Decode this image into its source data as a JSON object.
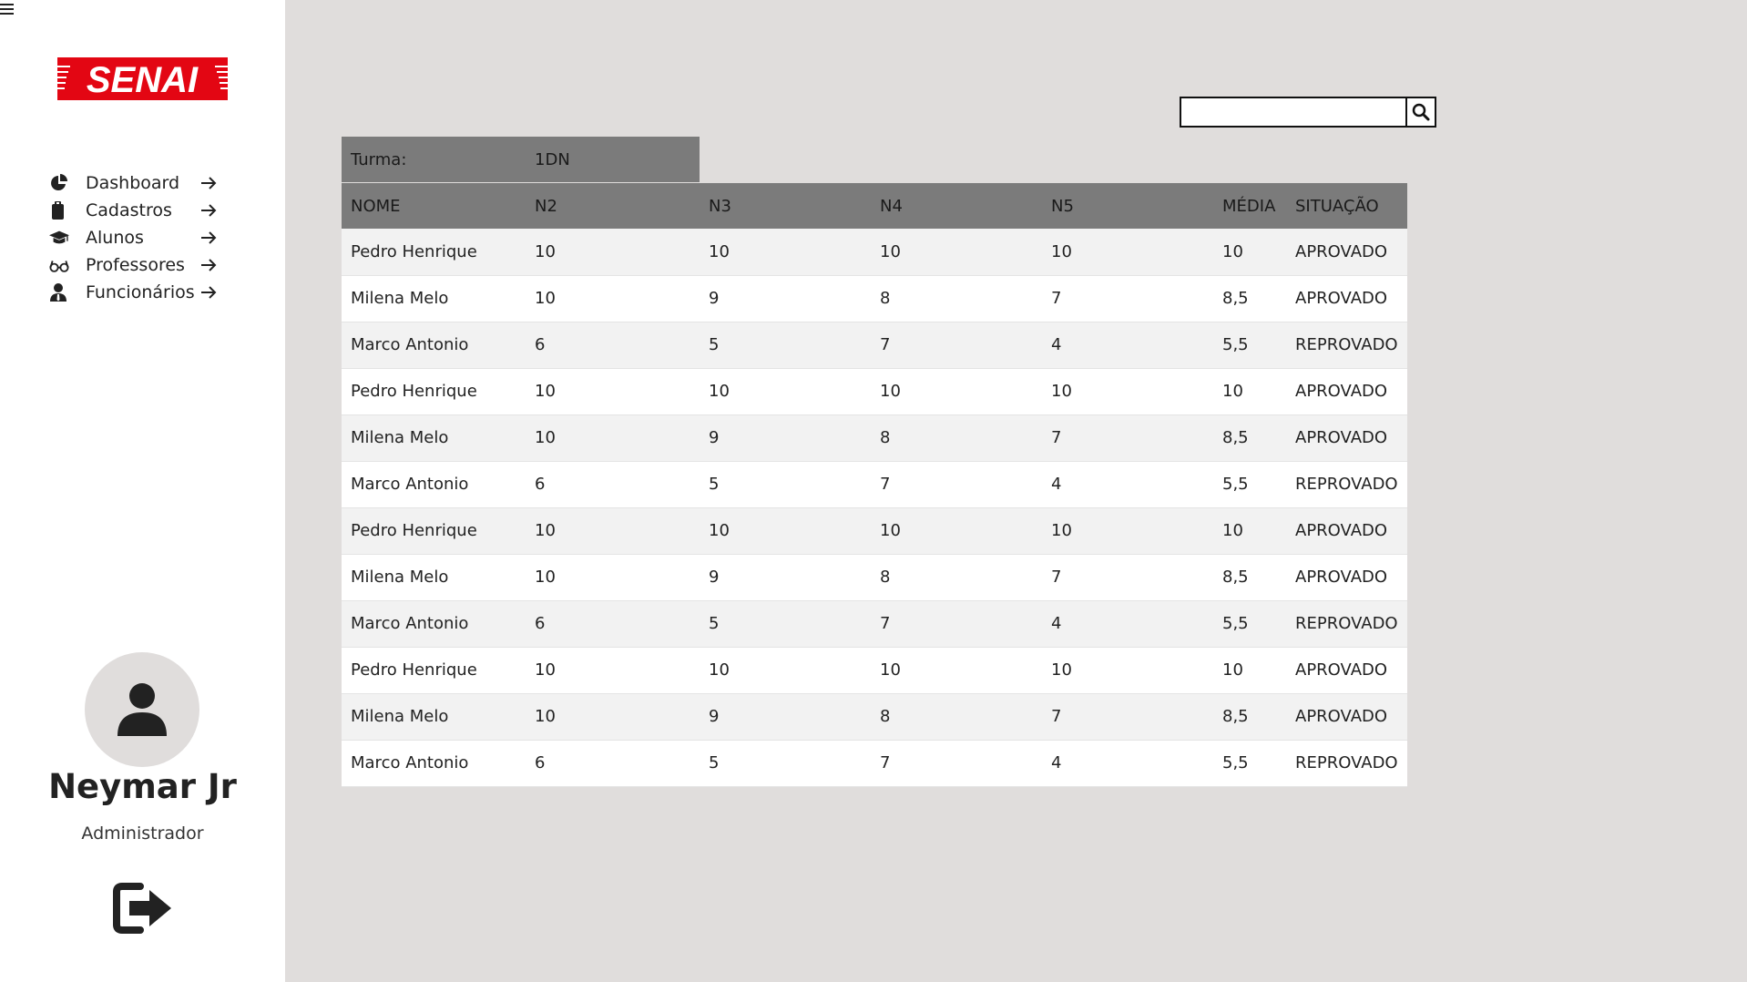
{
  "sidebar": {
    "logo_text": "SENAI",
    "nav": [
      {
        "label": "Dashboard",
        "icon": "pie-chart-icon"
      },
      {
        "label": "Cadastros",
        "icon": "clipboard-icon"
      },
      {
        "label": "Alunos",
        "icon": "graduation-cap-icon"
      },
      {
        "label": "Professores",
        "icon": "glasses-icon"
      },
      {
        "label": "Funcionários",
        "icon": "user-tie-icon"
      }
    ],
    "user": {
      "name": "Neymar Jr",
      "role": "Administrador"
    }
  },
  "search": {
    "value": "",
    "placeholder": ""
  },
  "turma": {
    "label": "Turma:",
    "value": "1DN"
  },
  "table": {
    "headers": [
      "NOME",
      "N2",
      "N3",
      "N4",
      "N5",
      "MÉDIA",
      "SITUAÇÃO"
    ],
    "rows": [
      [
        "Pedro Henrique",
        "10",
        "10",
        "10",
        "10",
        "10",
        "APROVADO"
      ],
      [
        "Milena Melo",
        "10",
        "9",
        "8",
        "7",
        "8,5",
        "APROVADO"
      ],
      [
        "Marco Antonio",
        "6",
        "5",
        "7",
        "4",
        "5,5",
        "REPROVADO"
      ],
      [
        "Pedro Henrique",
        "10",
        "10",
        "10",
        "10",
        "10",
        "APROVADO"
      ],
      [
        "Milena Melo",
        "10",
        "9",
        "8",
        "7",
        "8,5",
        "APROVADO"
      ],
      [
        "Marco Antonio",
        "6",
        "5",
        "7",
        "4",
        "5,5",
        "REPROVADO"
      ],
      [
        "Pedro Henrique",
        "10",
        "10",
        "10",
        "10",
        "10",
        "APROVADO"
      ],
      [
        "Milena Melo",
        "10",
        "9",
        "8",
        "7",
        "8,5",
        "APROVADO"
      ],
      [
        "Marco Antonio",
        "6",
        "5",
        "7",
        "4",
        "5,5",
        "REPROVADO"
      ],
      [
        "Pedro Henrique",
        "10",
        "10",
        "10",
        "10",
        "10",
        "APROVADO"
      ],
      [
        "Milena Melo",
        "10",
        "9",
        "8",
        "7",
        "8,5",
        "APROVADO"
      ],
      [
        "Marco Antonio",
        "6",
        "5",
        "7",
        "4",
        "5,5",
        "REPROVADO"
      ]
    ]
  },
  "colors": {
    "brand": "#e30613",
    "header_bg": "#7b7b7b",
    "page_bg": "#e0dddc"
  }
}
